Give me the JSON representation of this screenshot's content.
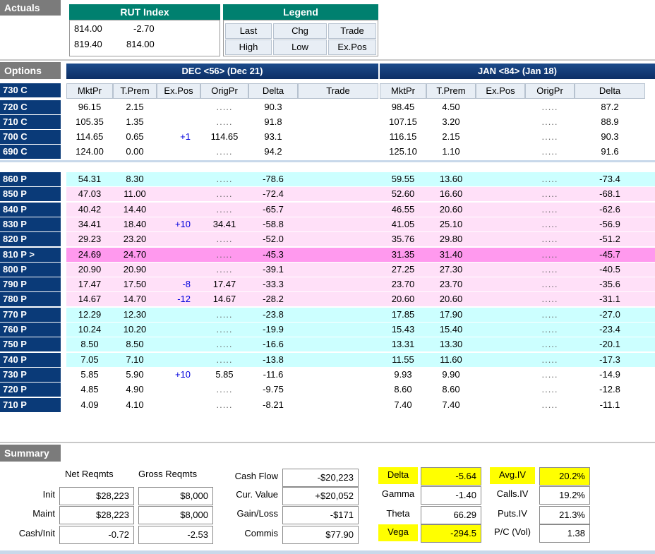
{
  "actuals": {
    "title": "Actuals",
    "index_title": "RUT Index",
    "values": [
      [
        "814.00",
        "-2.70"
      ],
      [
        "819.40",
        "814.00"
      ]
    ]
  },
  "legend": {
    "title": "Legend",
    "cells": [
      [
        "Last",
        "Chg",
        "Trade"
      ],
      [
        "High",
        "Low",
        "Ex.Pos"
      ]
    ]
  },
  "options": {
    "title": "Options",
    "dec_header": "DEC <56> (Dec 21)",
    "jan_header": "JAN <84> (Jan 18)",
    "dec_columns": [
      "MktPr",
      "T.Prem",
      "Ex.Pos",
      "OrigPr",
      "Delta",
      "Trade"
    ],
    "jan_columns": [
      "MktPr",
      "T.Prem",
      "Ex.Pos",
      "OrigPr",
      "Delta"
    ],
    "dots": ".....",
    "calls": [
      {
        "strike": "730 C"
      },
      {
        "strike": "720 C",
        "dec": [
          "96.15",
          "2.15",
          "",
          "",
          "90.3",
          ""
        ],
        "jan": [
          "98.45",
          "4.50",
          "",
          "",
          "87.2"
        ]
      },
      {
        "strike": "710 C",
        "dec": [
          "105.35",
          "1.35",
          "",
          "",
          "91.8",
          ""
        ],
        "jan": [
          "107.15",
          "3.20",
          "",
          "",
          "88.9"
        ]
      },
      {
        "strike": "700 C",
        "dec": [
          "114.65",
          "0.65",
          "+1",
          "114.65",
          "93.1",
          ""
        ],
        "jan": [
          "116.15",
          "2.15",
          "",
          "",
          "90.3"
        ]
      },
      {
        "strike": "690 C",
        "dec": [
          "124.00",
          "0.00",
          "",
          "",
          "94.2",
          ""
        ],
        "jan": [
          "125.10",
          "1.10",
          "",
          "",
          "91.6"
        ]
      }
    ],
    "puts": [
      {
        "strike": "860 P",
        "bg": "cyan",
        "dec": [
          "54.31",
          "8.30",
          "",
          "",
          "-78.6"
        ],
        "jan": [
          "59.55",
          "13.60",
          "",
          "",
          "-73.4"
        ]
      },
      {
        "strike": "850 P",
        "bg": "pink",
        "dec": [
          "47.03",
          "11.00",
          "",
          "",
          "-72.4"
        ],
        "jan": [
          "52.60",
          "16.60",
          "",
          "",
          "-68.1"
        ]
      },
      {
        "strike": "840 P",
        "bg": "pink",
        "dec": [
          "40.42",
          "14.40",
          "",
          "",
          "-65.7"
        ],
        "jan": [
          "46.55",
          "20.60",
          "",
          "",
          "-62.6"
        ]
      },
      {
        "strike": "830 P",
        "bg": "pink",
        "dec": [
          "34.41",
          "18.40",
          "+10",
          "34.41",
          "-58.8"
        ],
        "jan": [
          "41.05",
          "25.10",
          "",
          "",
          "-56.9"
        ]
      },
      {
        "strike": "820 P",
        "bg": "pink",
        "dec": [
          "29.23",
          "23.20",
          "",
          "",
          "-52.0"
        ],
        "jan": [
          "35.76",
          "29.80",
          "",
          "",
          "-51.2"
        ]
      },
      {
        "strike": "810 P >",
        "bg": "magenta",
        "dec": [
          "24.69",
          "24.70",
          "",
          "",
          "-45.3"
        ],
        "jan": [
          "31.35",
          "31.40",
          "",
          "",
          "-45.7"
        ]
      },
      {
        "strike": "800 P",
        "bg": "pink",
        "dec": [
          "20.90",
          "20.90",
          "",
          "",
          "-39.1"
        ],
        "jan": [
          "27.25",
          "27.30",
          "",
          "",
          "-40.5"
        ]
      },
      {
        "strike": "790 P",
        "bg": "pink",
        "dec": [
          "17.47",
          "17.50",
          "-8",
          "17.47",
          "-33.3"
        ],
        "jan": [
          "23.70",
          "23.70",
          "",
          "",
          "-35.6"
        ]
      },
      {
        "strike": "780 P",
        "bg": "pink",
        "dec": [
          "14.67",
          "14.70",
          "-12",
          "14.67",
          "-28.2"
        ],
        "jan": [
          "20.60",
          "20.60",
          "",
          "",
          "-31.1"
        ]
      },
      {
        "strike": "770 P",
        "bg": "cyan",
        "dec": [
          "12.29",
          "12.30",
          "",
          "",
          "-23.8"
        ],
        "jan": [
          "17.85",
          "17.90",
          "",
          "",
          "-27.0"
        ]
      },
      {
        "strike": "760 P",
        "bg": "cyan",
        "dec": [
          "10.24",
          "10.20",
          "",
          "",
          "-19.9"
        ],
        "jan": [
          "15.43",
          "15.40",
          "",
          "",
          "-23.4"
        ]
      },
      {
        "strike": "750 P",
        "bg": "cyan",
        "dec": [
          "8.50",
          "8.50",
          "",
          "",
          "-16.6"
        ],
        "jan": [
          "13.31",
          "13.30",
          "",
          "",
          "-20.1"
        ]
      },
      {
        "strike": "740 P",
        "bg": "cyan",
        "dec": [
          "7.05",
          "7.10",
          "",
          "",
          "-13.8"
        ],
        "jan": [
          "11.55",
          "11.60",
          "",
          "",
          "-17.3"
        ]
      },
      {
        "strike": "730 P",
        "bg": "white",
        "dec": [
          "5.85",
          "5.90",
          "+10",
          "5.85",
          "-11.6"
        ],
        "jan": [
          "9.93",
          "9.90",
          "",
          "",
          "-14.9"
        ]
      },
      {
        "strike": "720 P",
        "bg": "white",
        "dec": [
          "4.85",
          "4.90",
          "",
          "",
          "-9.75"
        ],
        "jan": [
          "8.60",
          "8.60",
          "",
          "",
          "-12.8"
        ]
      },
      {
        "strike": "710 P",
        "bg": "white",
        "dec": [
          "4.09",
          "4.10",
          "",
          "",
          "-8.21"
        ],
        "jan": [
          "7.40",
          "7.40",
          "",
          "",
          "-11.1"
        ]
      }
    ]
  },
  "summary": {
    "title": "Summary",
    "net_reqmts_label": "Net Reqmts",
    "gross_reqmts_label": "Gross Reqmts",
    "rows": [
      {
        "label": "Init",
        "net": "$28,223",
        "gross": "$8,000"
      },
      {
        "label": "Maint",
        "net": "$28,223",
        "gross": "$8,000"
      },
      {
        "label": "Cash/Init",
        "net": "-0.72",
        "gross": "-2.53"
      }
    ],
    "cash": [
      {
        "label": "Cash Flow",
        "value": "-$20,223"
      },
      {
        "label": "Cur. Value",
        "value": "+$20,052"
      },
      {
        "label": "Gain/Loss",
        "value": "-$171"
      },
      {
        "label": "Commis",
        "value": "$77.90"
      }
    ],
    "greeks": [
      {
        "label": "Delta",
        "value": "-5.64"
      },
      {
        "label": "Gamma",
        "value": "-1.40"
      },
      {
        "label": "Theta",
        "value": "66.29"
      },
      {
        "label": "Vega",
        "value": "-294.5"
      }
    ],
    "iv": [
      {
        "label": "Avg.IV",
        "value": "20.2%"
      },
      {
        "label": "Calls.IV",
        "value": "19.2%"
      },
      {
        "label": "Puts.IV",
        "value": "21.3%"
      },
      {
        "label": "P/C (Vol)",
        "value": "1.38"
      }
    ]
  },
  "colors": {
    "cyan": "#ccffff",
    "pink": "#ffe0f8",
    "magenta": "#ff99ee",
    "white": "#ffffff",
    "highlight": "#ffff00"
  }
}
